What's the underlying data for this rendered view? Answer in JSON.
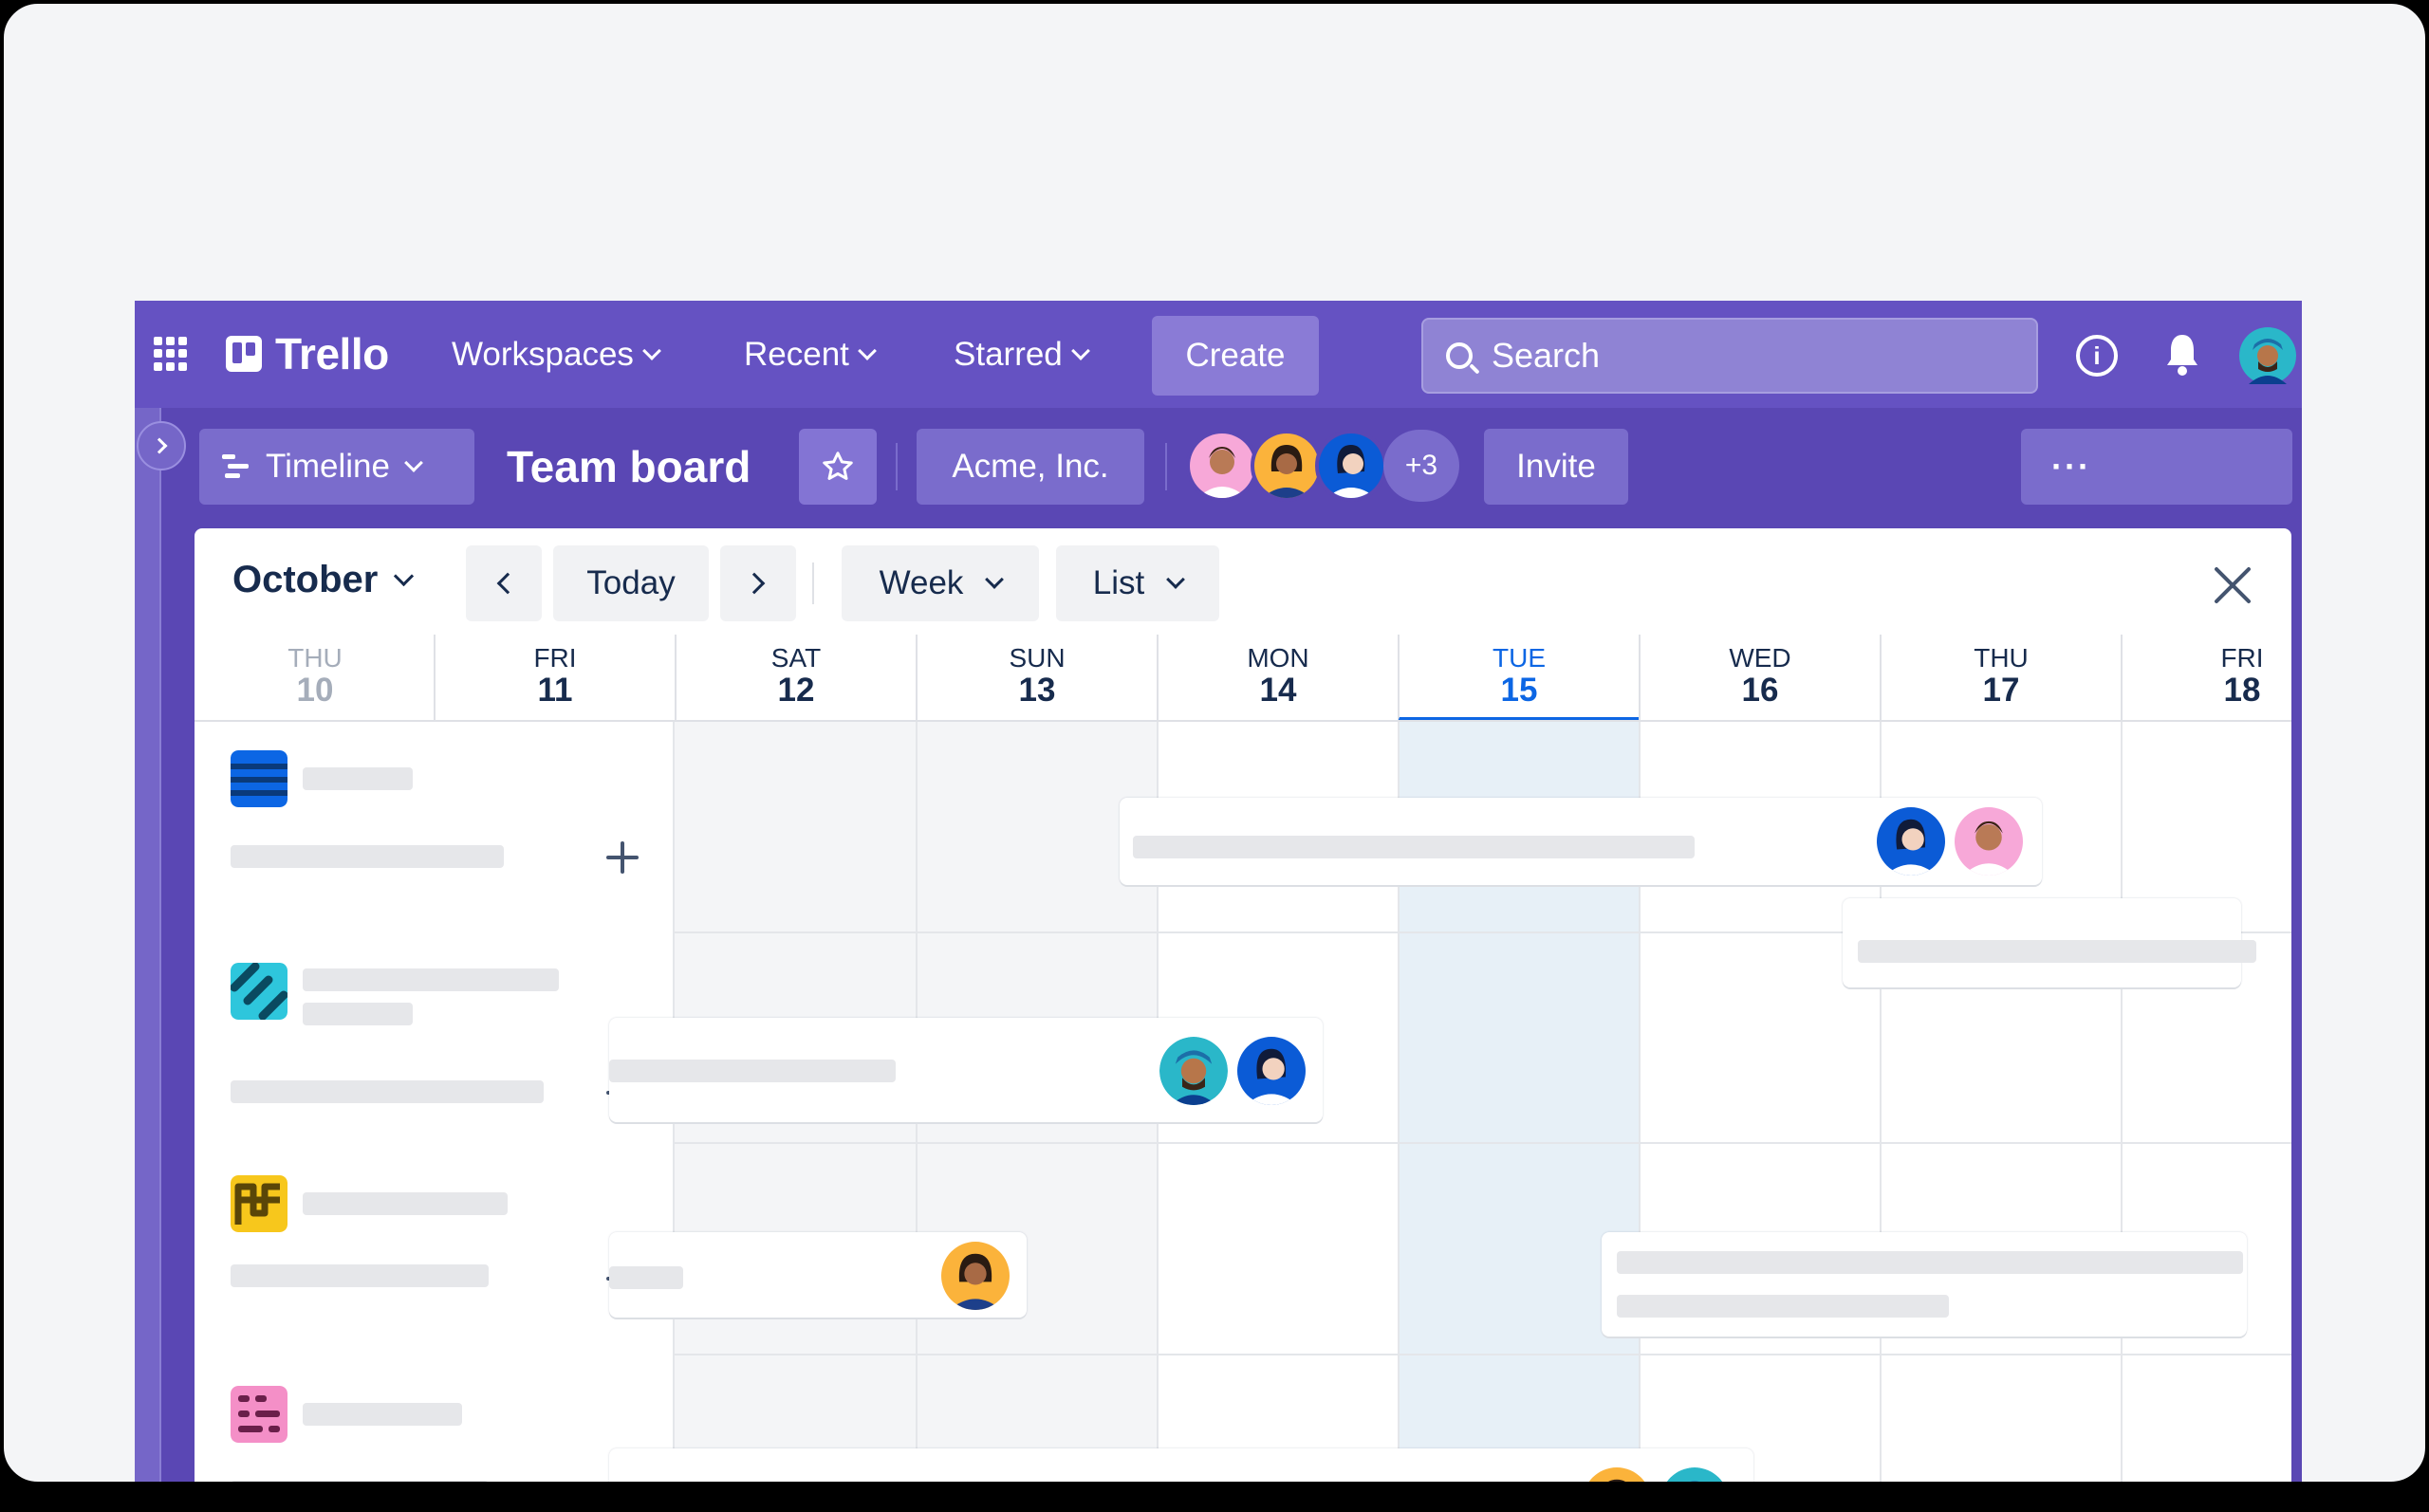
{
  "nav": {
    "logo": "Trello",
    "workspaces": "Workspaces",
    "recent": "Recent",
    "starred": "Starred",
    "create": "Create",
    "search_placeholder": "Search",
    "info_glyph": "i"
  },
  "board": {
    "view": "Timeline",
    "title": "Team board",
    "workspace": "Acme, Inc.",
    "extra_members": "+3",
    "invite": "Invite",
    "more": "···"
  },
  "calendar": {
    "month": "October",
    "today": "Today",
    "range": "Week",
    "group": "List",
    "days": [
      {
        "dow": "THU",
        "num": "10"
      },
      {
        "dow": "FRI",
        "num": "11"
      },
      {
        "dow": "SAT",
        "num": "12"
      },
      {
        "dow": "SUN",
        "num": "13"
      },
      {
        "dow": "MON",
        "num": "14"
      },
      {
        "dow": "TUE",
        "num": "15"
      },
      {
        "dow": "WED",
        "num": "16"
      },
      {
        "dow": "THU",
        "num": "17"
      },
      {
        "dow": "FRI",
        "num": "18"
      }
    ]
  },
  "colors": {
    "nav": "#6552c2",
    "board": "#5a47b4",
    "accent_today": "#0c66e4"
  },
  "icons": [
    "grid-icon",
    "info-icon",
    "bell-icon",
    "search-icon",
    "star-icon",
    "timeline-icon",
    "close-icon",
    "plus-icon"
  ]
}
